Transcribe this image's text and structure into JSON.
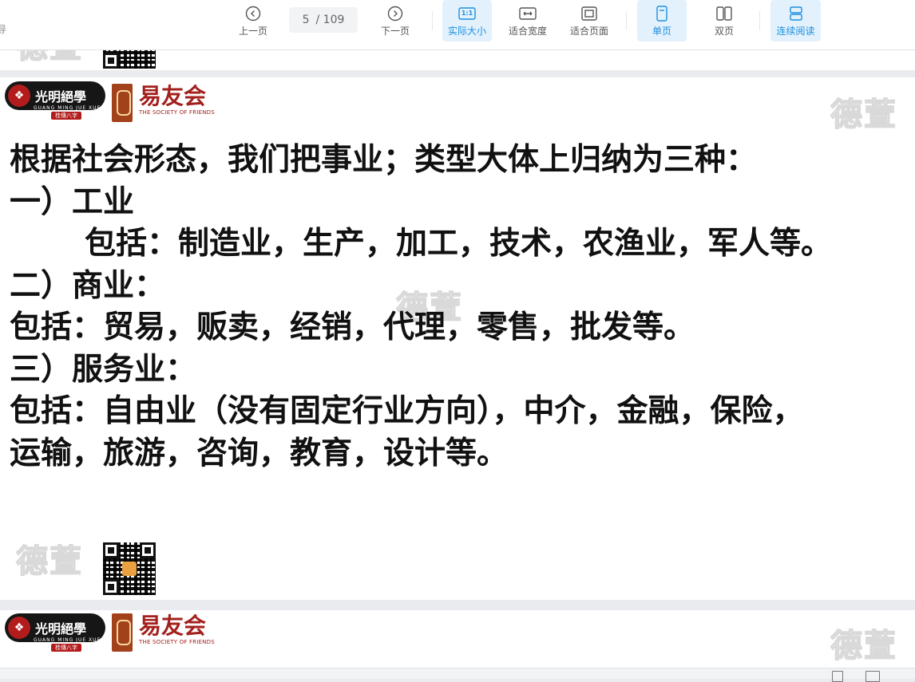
{
  "toolbar": {
    "left_fragment": "导",
    "prev_label": "上一页",
    "next_label": "下一页",
    "current_page": "5",
    "total_pages": "/ 109",
    "actual_size_label": "实际大小",
    "actual_size_icon_text": "1:1",
    "fit_width_label": "适合宽度",
    "fit_page_label": "适合页面",
    "single_page_label": "单页",
    "double_page_label": "双页",
    "continuous_label": "连续阅读",
    "accent_color": "#1a8fe0"
  },
  "branding": {
    "logo_a_name": "光明絕學",
    "logo_a_sub": "GUANG MING JUE XUE",
    "logo_a_tag": "桂傳八字",
    "logo_b_name": "易友会",
    "logo_b_sub": "THE SOCIETY OF FRIENDS",
    "watermark": "德萱"
  },
  "document": {
    "lines": [
      "根据社会形态，我们把事业；类型大体上归纳为三种：",
      "一）工业",
      "包括：制造业，生产，加工，技术，农渔业，军人等。",
      "二）商业：",
      "包括：贸易，贩卖，经销，代理，零售，批发等。",
      "三）服务业：",
      "包括：自由业（没有固定行业方向），中介，金融，保险，",
      "运输，旅游，咨询，教育，设计等。"
    ]
  }
}
